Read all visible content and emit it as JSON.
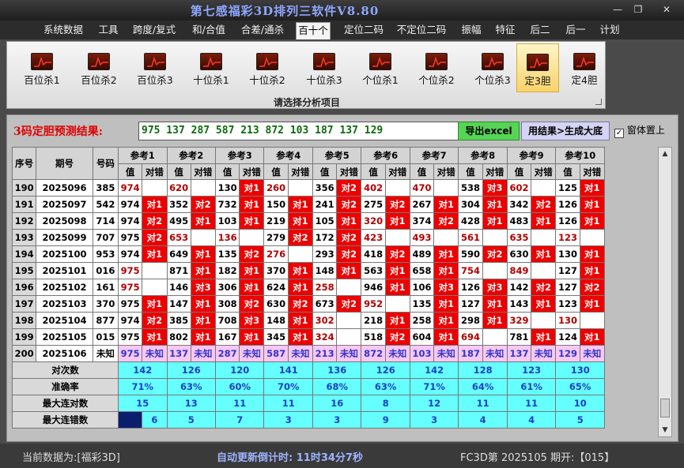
{
  "title": "第七感福彩3D排列三软件V8.80",
  "window_buttons": [
    "—",
    "❐",
    "✕"
  ],
  "menu": [
    "系统数据",
    "工具",
    "跨度/复式",
    "和/合值",
    "合差/通杀",
    "百十个",
    "定位二码",
    "不定位二码",
    "振幅",
    "特征",
    "后二",
    "后一",
    "计划"
  ],
  "active_menu": "百十个",
  "ribbon_buttons": [
    "百位杀1",
    "百位杀2",
    "百位杀3",
    "十位杀1",
    "十位杀2",
    "十位杀3",
    "个位杀1",
    "个位杀2",
    "个位杀3",
    "定3胆",
    "定4胆"
  ],
  "ribbon_selected": "定3胆",
  "ribbon_caption": "请选择分析项目",
  "result_label": "3码定胆预测结果:",
  "result_text": "975 137 287 587 213 872 103 187 137 129",
  "export_label": "导出excel",
  "generate_label": "用结果>生成大底",
  "topmost_label": "窗体置上",
  "topmost_checked": true,
  "table": {
    "col_seq": "序号",
    "col_period": "期号",
    "col_number": "号码",
    "ref_headers": [
      "参考1",
      "参考2",
      "参考3",
      "参考4",
      "参考5",
      "参考6",
      "参考7",
      "参考8",
      "参考9",
      "参考10"
    ],
    "sub_value": "值",
    "sub_hit": "对错",
    "rows": [
      {
        "seq": "190",
        "period": "2025096",
        "num": "385",
        "cells": [
          [
            "974",
            "",
            1
          ],
          [
            "620",
            "",
            1
          ],
          [
            "130",
            "对1",
            0
          ],
          [
            "260",
            "",
            1
          ],
          [
            "356",
            "对2",
            0
          ],
          [
            "402",
            "",
            1
          ],
          [
            "470",
            "",
            1
          ],
          [
            "538",
            "对3",
            0
          ],
          [
            "602",
            "",
            1
          ],
          [
            "125",
            "对1",
            0
          ]
        ]
      },
      {
        "seq": "191",
        "period": "2025097",
        "num": "542",
        "cells": [
          [
            "974",
            "对1",
            0
          ],
          [
            "352",
            "对2",
            0
          ],
          [
            "732",
            "对1",
            0
          ],
          [
            "150",
            "对1",
            0
          ],
          [
            "241",
            "对2",
            0
          ],
          [
            "275",
            "对2",
            0
          ],
          [
            "267",
            "对1",
            0
          ],
          [
            "304",
            "对1",
            0
          ],
          [
            "342",
            "对2",
            0
          ],
          [
            "126",
            "对1",
            0
          ]
        ]
      },
      {
        "seq": "192",
        "period": "2025098",
        "num": "714",
        "cells": [
          [
            "974",
            "对2",
            0
          ],
          [
            "495",
            "对1",
            0
          ],
          [
            "103",
            "对1",
            0
          ],
          [
            "219",
            "对1",
            0
          ],
          [
            "105",
            "对1",
            0
          ],
          [
            "320",
            "对1",
            1
          ],
          [
            "374",
            "对2",
            0
          ],
          [
            "428",
            "对1",
            0
          ],
          [
            "483",
            "对1",
            0
          ],
          [
            "126",
            "对1",
            0
          ]
        ]
      },
      {
        "seq": "193",
        "period": "2025099",
        "num": "707",
        "cells": [
          [
            "975",
            "对2",
            0
          ],
          [
            "653",
            "",
            1
          ],
          [
            "136",
            "",
            1
          ],
          [
            "279",
            "对2",
            0
          ],
          [
            "172",
            "对2",
            0
          ],
          [
            "423",
            "",
            1
          ],
          [
            "493",
            "",
            1
          ],
          [
            "561",
            "",
            1
          ],
          [
            "635",
            "",
            1
          ],
          [
            "123",
            "",
            1
          ]
        ]
      },
      {
        "seq": "194",
        "period": "2025100",
        "num": "953",
        "cells": [
          [
            "974",
            "对1",
            0
          ],
          [
            "649",
            "对1",
            0
          ],
          [
            "135",
            "对2",
            0
          ],
          [
            "276",
            "",
            1
          ],
          [
            "293",
            "对2",
            0
          ],
          [
            "418",
            "对2",
            0
          ],
          [
            "489",
            "对1",
            0
          ],
          [
            "590",
            "对2",
            0
          ],
          [
            "630",
            "对1",
            0
          ],
          [
            "130",
            "对1",
            0
          ]
        ]
      },
      {
        "seq": "195",
        "period": "2025101",
        "num": "016",
        "cells": [
          [
            "975",
            "",
            1
          ],
          [
            "871",
            "对1",
            0
          ],
          [
            "182",
            "对1",
            0
          ],
          [
            "370",
            "对1",
            0
          ],
          [
            "148",
            "对1",
            0
          ],
          [
            "563",
            "对1",
            0
          ],
          [
            "658",
            "对1",
            0
          ],
          [
            "754",
            "",
            1
          ],
          [
            "849",
            "",
            1
          ],
          [
            "127",
            "对1",
            0
          ]
        ]
      },
      {
        "seq": "196",
        "period": "2025102",
        "num": "161",
        "cells": [
          [
            "975",
            "",
            1
          ],
          [
            "146",
            "对3",
            0
          ],
          [
            "306",
            "对1",
            0
          ],
          [
            "624",
            "对1",
            0
          ],
          [
            "258",
            "",
            1
          ],
          [
            "946",
            "对1",
            0
          ],
          [
            "106",
            "对3",
            0
          ],
          [
            "126",
            "对3",
            0
          ],
          [
            "142",
            "对2",
            0
          ],
          [
            "127",
            "对2",
            0
          ]
        ]
      },
      {
        "seq": "197",
        "period": "2025103",
        "num": "370",
        "cells": [
          [
            "975",
            "对1",
            0
          ],
          [
            "147",
            "对1",
            0
          ],
          [
            "308",
            "对2",
            0
          ],
          [
            "630",
            "对2",
            0
          ],
          [
            "673",
            "对2",
            0
          ],
          [
            "952",
            "",
            1
          ],
          [
            "135",
            "对1",
            0
          ],
          [
            "127",
            "对1",
            0
          ],
          [
            "143",
            "对1",
            0
          ],
          [
            "123",
            "对1",
            0
          ]
        ]
      },
      {
        "seq": "198",
        "period": "2025104",
        "num": "877",
        "cells": [
          [
            "974",
            "对2",
            0
          ],
          [
            "385",
            "对1",
            0
          ],
          [
            "708",
            "对3",
            0
          ],
          [
            "148",
            "对1",
            0
          ],
          [
            "302",
            "",
            1
          ],
          [
            "218",
            "对1",
            0
          ],
          [
            "258",
            "对1",
            0
          ],
          [
            "298",
            "对1",
            0
          ],
          [
            "329",
            "",
            1
          ],
          [
            "130",
            "",
            1
          ]
        ]
      },
      {
        "seq": "199",
        "period": "2025105",
        "num": "015",
        "cells": [
          [
            "975",
            "对1",
            0
          ],
          [
            "802",
            "对1",
            0
          ],
          [
            "167",
            "对1",
            0
          ],
          [
            "345",
            "对1",
            0
          ],
          [
            "324",
            "",
            1
          ],
          [
            "518",
            "对2",
            0
          ],
          [
            "604",
            "对1",
            0
          ],
          [
            "694",
            "",
            1
          ],
          [
            "781",
            "对1",
            0
          ],
          [
            "124",
            "对1",
            0
          ]
        ]
      }
    ],
    "pending_row": {
      "seq": "200",
      "period": "2025106",
      "num": "未知",
      "values": [
        "975",
        "137",
        "287",
        "587",
        "213",
        "872",
        "103",
        "187",
        "137",
        "129"
      ],
      "hit": "未知"
    },
    "stats": [
      {
        "label": "对次数",
        "values": [
          "142",
          "126",
          "120",
          "141",
          "136",
          "126",
          "142",
          "128",
          "123",
          "130"
        ]
      },
      {
        "label": "准确率",
        "values": [
          "71%",
          "63%",
          "60%",
          "70%",
          "68%",
          "63%",
          "71%",
          "64%",
          "61%",
          "65%"
        ]
      },
      {
        "label": "最大连对数",
        "values": [
          "15",
          "13",
          "11",
          "11",
          "16",
          "8",
          "12",
          "11",
          "11",
          "10"
        ]
      },
      {
        "label": "最大连错数",
        "values": [
          "6",
          "5",
          "7",
          "3",
          "3",
          "9",
          "3",
          "4",
          "4",
          "5"
        ]
      }
    ]
  },
  "status": {
    "left": "当前数据为:[福彩3D]",
    "middle": "自动更新倒计时: 11时34分7秒",
    "right": "FC3D第 2025105 期开:【015】"
  }
}
